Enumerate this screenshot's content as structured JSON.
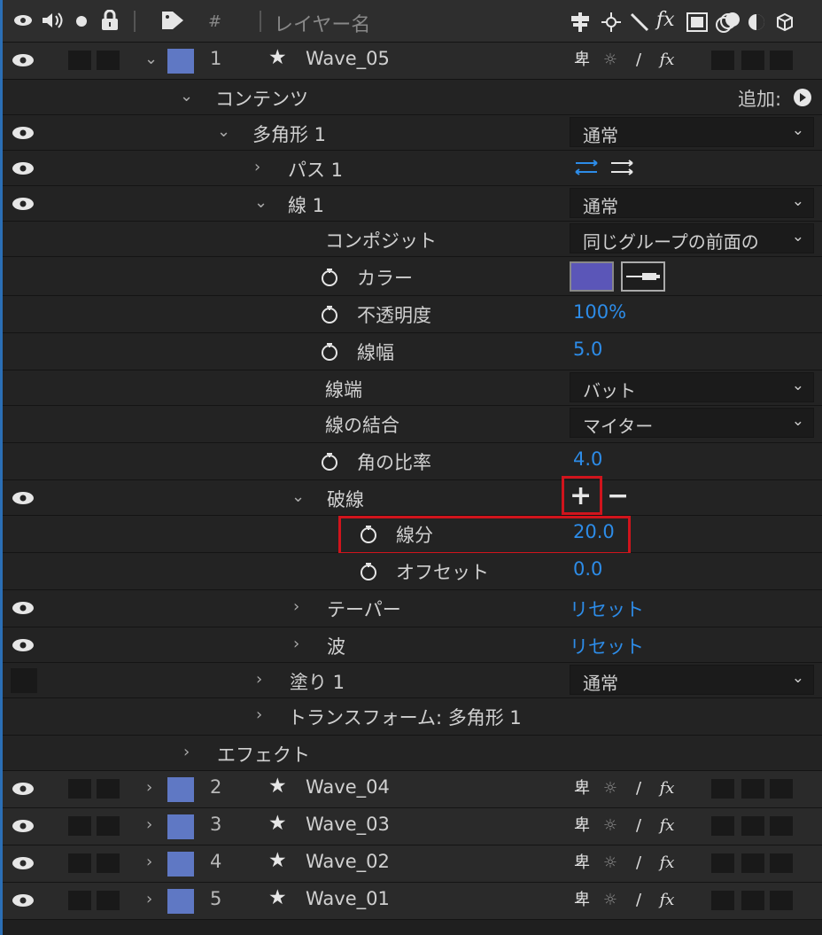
{
  "header": {
    "hash": "#",
    "layer_name": "レイヤー名",
    "fx": "fx"
  },
  "layers_top": {
    "number": "1",
    "name": "Wave_05"
  },
  "contents": {
    "label": "コンテンツ",
    "add_label": "追加:"
  },
  "polygon": {
    "label": "多角形 1",
    "mode": "通常"
  },
  "path": {
    "label": "パス 1"
  },
  "stroke": {
    "label": "線 1",
    "mode": "通常",
    "composite_label": "コンポジット",
    "composite_value": "同じグループの前面の",
    "color_label": "カラー",
    "opacity_label": "不透明度",
    "opacity_value": "100%",
    "width_label": "線幅",
    "width_value": "5.0",
    "cap_label": "線端",
    "cap_value": "バット",
    "join_label": "線の結合",
    "join_value": "マイター",
    "miter_label": "角の比率",
    "miter_value": "4.0",
    "color": "#5b56b8"
  },
  "dashes": {
    "label": "破線",
    "plus": "+",
    "minus": "−",
    "dash_label": "線分",
    "dash_value": "20.0",
    "offset_label": "オフセット",
    "offset_value": "0.0"
  },
  "taper": {
    "label": "テーパー",
    "reset": "リセット"
  },
  "wave": {
    "label": "波",
    "reset": "リセット"
  },
  "fill": {
    "label": "塗り 1",
    "mode": "通常"
  },
  "transform": {
    "label": "トランスフォーム: 多角形 1"
  },
  "effects": {
    "label": "エフェクト"
  },
  "layers": [
    {
      "number": "2",
      "name": "Wave_04"
    },
    {
      "number": "3",
      "name": "Wave_03"
    },
    {
      "number": "4",
      "name": "Wave_02"
    },
    {
      "number": "5",
      "name": "Wave_01"
    }
  ],
  "switch_labels": {
    "fx": "fx"
  },
  "colors": {
    "accent": "#2d8ce8",
    "label_blue": "#5f78c4",
    "highlight": "#d0141c"
  }
}
